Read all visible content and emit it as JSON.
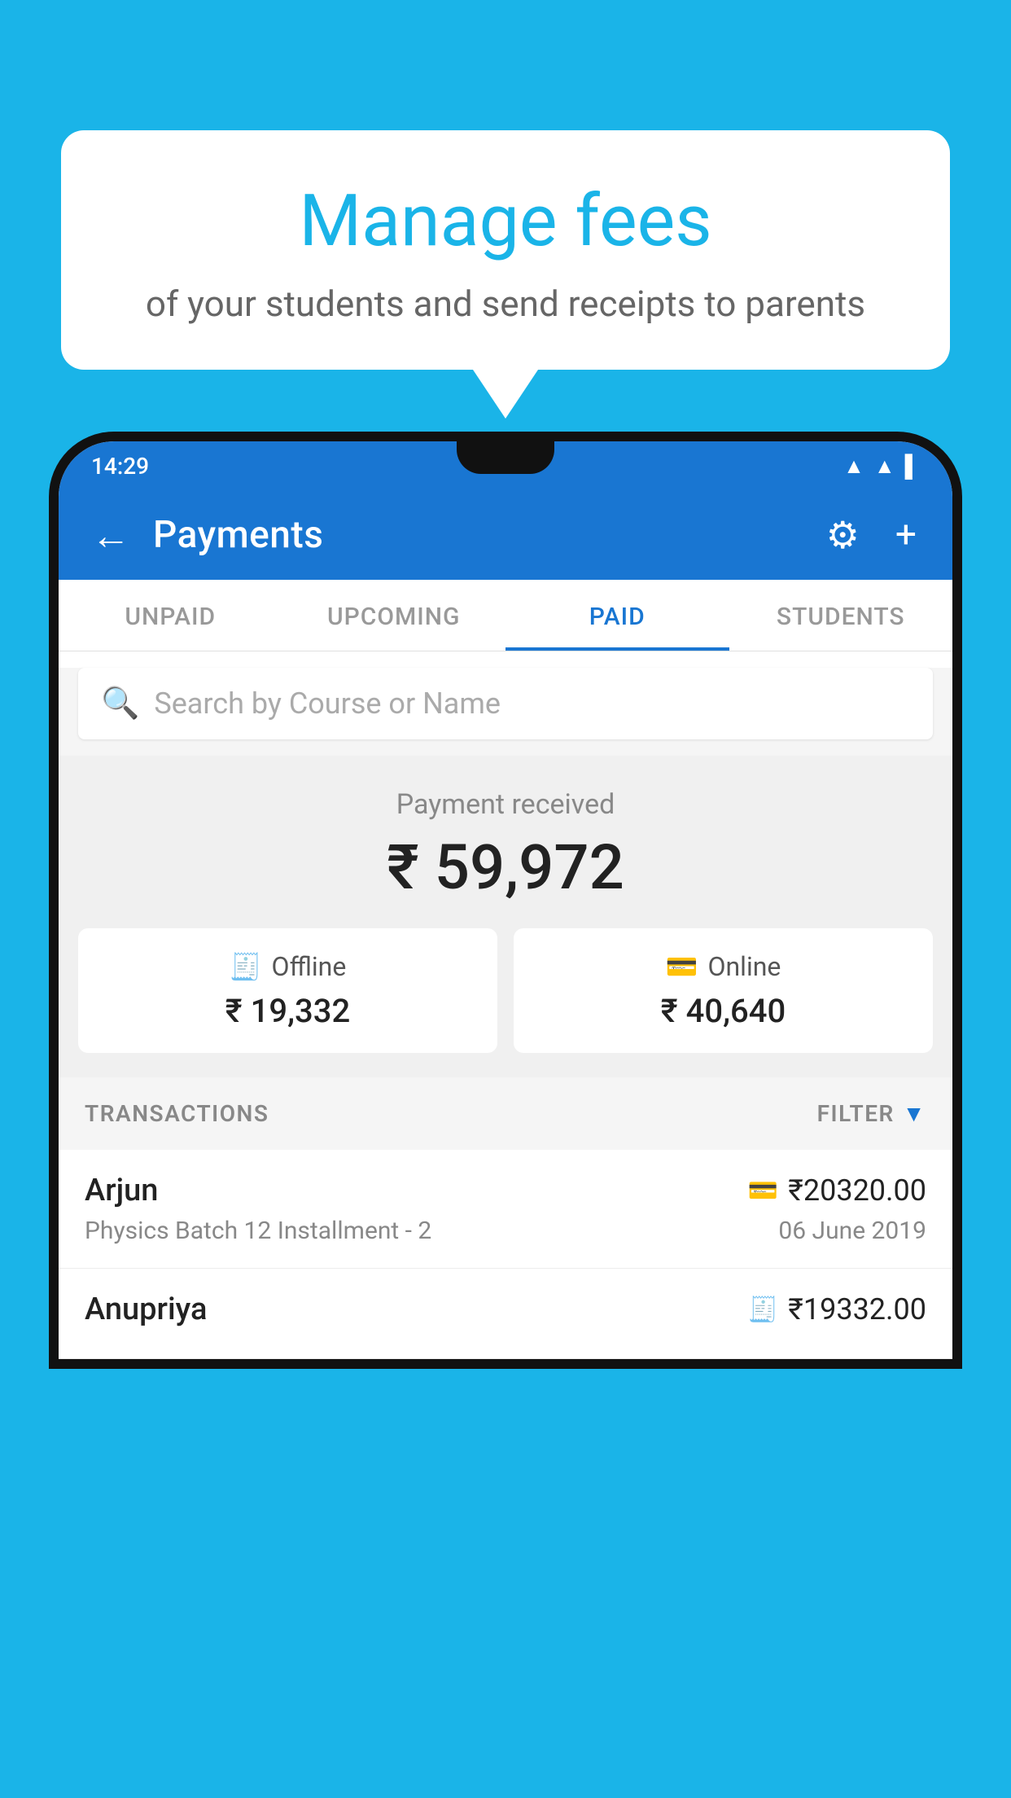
{
  "background_color": "#1ab4e8",
  "speech_bubble": {
    "title": "Manage fees",
    "subtitle": "of your students and send receipts to parents"
  },
  "status_bar": {
    "time": "14:29",
    "wifi_symbol": "▲",
    "signal_symbol": "▲",
    "battery_symbol": "▌"
  },
  "app_bar": {
    "title": "Payments",
    "back_label": "←",
    "gear_label": "⚙",
    "plus_label": "+"
  },
  "tabs": [
    {
      "label": "UNPAID",
      "active": false
    },
    {
      "label": "UPCOMING",
      "active": false
    },
    {
      "label": "PAID",
      "active": true
    },
    {
      "label": "STUDENTS",
      "active": false
    }
  ],
  "search": {
    "placeholder": "Search by Course or Name"
  },
  "payment_received": {
    "label": "Payment received",
    "amount": "₹ 59,972",
    "offline": {
      "type": "Offline",
      "amount": "₹ 19,332",
      "icon": "▣"
    },
    "online": {
      "type": "Online",
      "amount": "₹ 40,640",
      "icon": "▬"
    }
  },
  "transactions_section": {
    "label": "TRANSACTIONS",
    "filter_label": "FILTER",
    "filter_icon": "▼"
  },
  "transactions": [
    {
      "name": "Arjun",
      "amount": "₹20320.00",
      "course": "Physics Batch 12 Installment - 2",
      "date": "06 June 2019",
      "payment_icon": "▬"
    },
    {
      "name": "Anupriya",
      "amount": "₹19332.00",
      "course": "",
      "date": "",
      "payment_icon": "▣"
    }
  ]
}
